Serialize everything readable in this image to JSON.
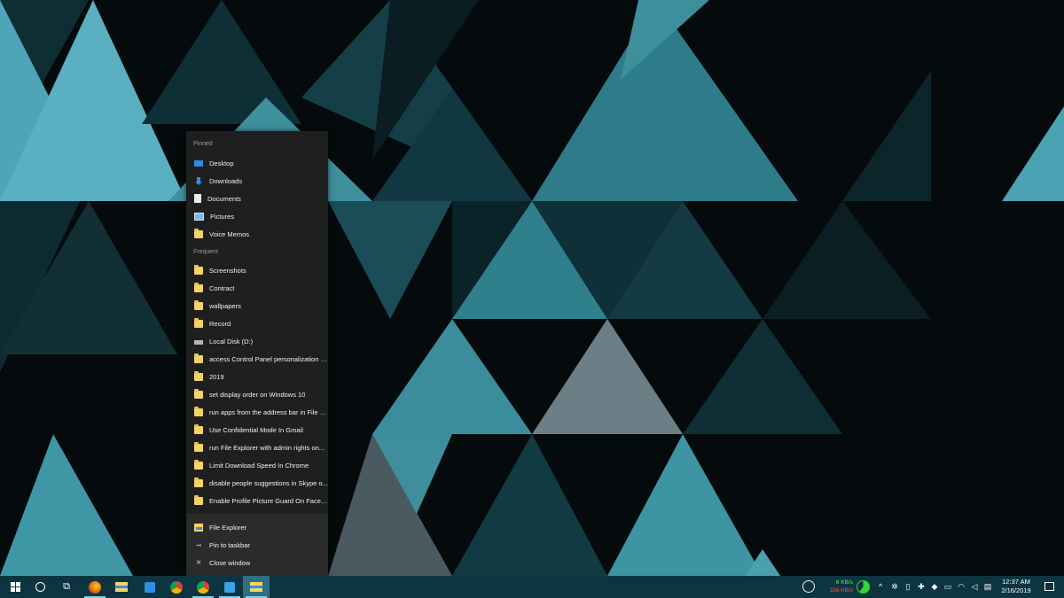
{
  "jump_list": {
    "pinned_label": "Pinned",
    "pinned": [
      {
        "label": "Desktop",
        "icon": "desktop-icon"
      },
      {
        "label": "Downloads",
        "icon": "downloads-icon"
      },
      {
        "label": "Documents",
        "icon": "documents-icon"
      },
      {
        "label": "Pictures",
        "icon": "pictures-icon"
      },
      {
        "label": "Voice Memos",
        "icon": "folder-icon"
      }
    ],
    "frequent_label": "Frequent",
    "frequent": [
      {
        "label": "Screenshots",
        "icon": "folder-icon"
      },
      {
        "label": "Contract",
        "icon": "folder-icon"
      },
      {
        "label": "wallpapers",
        "icon": "folder-icon"
      },
      {
        "label": "Record",
        "icon": "folder-icon"
      },
      {
        "label": "Local Disk (D:)",
        "icon": "drive-icon"
      },
      {
        "label": "access Control Panel personalization se...",
        "icon": "folder-icon"
      },
      {
        "label": "2019",
        "icon": "folder-icon"
      },
      {
        "label": "set display order on Windows 10",
        "icon": "folder-icon"
      },
      {
        "label": "run apps from the address bar in File E...",
        "icon": "folder-icon"
      },
      {
        "label": "Use Confidential Mode In Gmail",
        "icon": "folder-icon"
      },
      {
        "label": "run File Explorer with admin rights on...",
        "icon": "folder-icon"
      },
      {
        "label": "Limit Download Speed In Chrome",
        "icon": "folder-icon"
      },
      {
        "label": "disable people suggestions in Skype o...",
        "icon": "folder-icon"
      },
      {
        "label": "Enable Profile Picture Guard On Faceb...",
        "icon": "folder-icon"
      }
    ],
    "tasks": [
      {
        "label": "File Explorer",
        "icon": "file-explorer-icon"
      },
      {
        "label": "Pin to taskbar",
        "icon": "pin-icon"
      },
      {
        "label": "Close window",
        "icon": "close-icon"
      }
    ]
  },
  "taskbar": {
    "apps": [
      {
        "name": "start-button",
        "icon": "windows-logo-icon"
      },
      {
        "name": "cortana-button",
        "icon": "cortana-circle-icon"
      },
      {
        "name": "task-view-button",
        "icon": "task-view-icon"
      },
      {
        "name": "firefox-button",
        "icon": "firefox-icon"
      },
      {
        "name": "file-explorer-pinned-button",
        "icon": "folder-icon"
      },
      {
        "name": "app-button",
        "icon": "app-icon"
      },
      {
        "name": "chrome-button",
        "icon": "chrome-icon"
      },
      {
        "name": "chrome-second-button",
        "icon": "chrome-icon"
      },
      {
        "name": "app-button-2",
        "icon": "app-icon"
      },
      {
        "name": "file-explorer-active-button",
        "icon": "folder-icon"
      }
    ],
    "net_up": "6 KB/s",
    "net_down": "336 KB/s",
    "clock_time": "12:37 AM",
    "clock_date": "2/16/2019"
  },
  "colors": {
    "taskbar_bg": "#0d3541",
    "jump_list_bg": "#1f1f1f",
    "accent": "#7fd0ee",
    "teal": "#4ea5b5"
  }
}
